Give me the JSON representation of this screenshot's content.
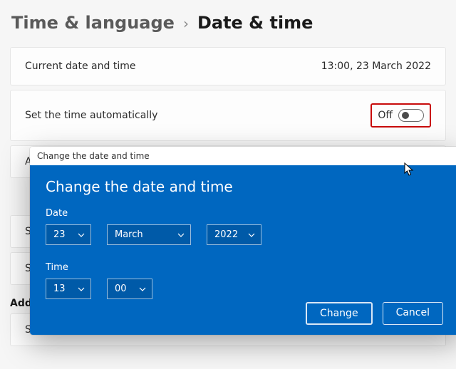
{
  "breadcrumb": {
    "parent": "Time & language",
    "sep": "›",
    "current": "Date & time"
  },
  "panels": {
    "current": {
      "label": "Current date and time",
      "value": "13:00, 23 March 2022"
    },
    "autoTime": {
      "label": "Set the time automatically",
      "stateLabel": "Off"
    },
    "rowA": {
      "label": "A"
    },
    "rowSe1": {
      "label": "Se"
    },
    "rowSe2": {
      "label": "Se"
    },
    "additional": {
      "heading": "Addi"
    },
    "rowSy": {
      "label": "Sy"
    }
  },
  "dialog": {
    "title": "Change the date and time",
    "heading": "Change the date and time",
    "dateLabel": "Date",
    "timeLabel": "Time",
    "date": {
      "day": "23",
      "month": "March",
      "year": "2022"
    },
    "time": {
      "hour": "13",
      "minute": "00"
    },
    "actions": {
      "change": "Change",
      "cancel": "Cancel"
    }
  }
}
